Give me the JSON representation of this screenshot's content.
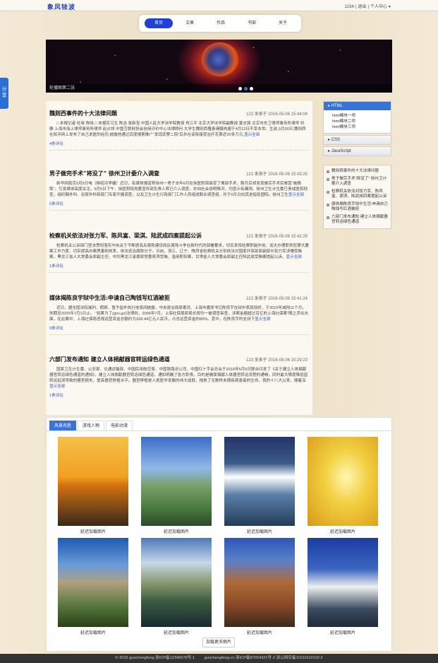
{
  "header": {
    "logo": "象风铱波",
    "user_links": [
      "1234",
      "|",
      "退出",
      "|",
      "个人中心"
    ],
    "nav": [
      "首页",
      "文章",
      "作品",
      "书架",
      "关于"
    ],
    "active_nav": 0
  },
  "banner": {
    "caption": "轮播图第二张",
    "dots": 3,
    "active_dot": 1
  },
  "share": {
    "label": "分享"
  },
  "articles": [
    {
      "title": "魏则西事件的十大法律问题",
      "meta": "123 发表于 2016-05-06 15:44:04",
      "summary": "□ 本报记者 杜晓 陈晓 □ 本报实习生 陈洁 张新宝 中国人民大学法学院教授 肖江平 北京大学法学院副教授 夏志强 北京市东卫律师事务所律师 刘 静 上海市海上律师事务所律师 赵占领 中国互联网协会信用评价中心法律顾问 大学生魏则西罹患滑膜肉瘤于4月12日不幸去世。生前,3月30日,魏则西在知乎网上发布了自己求医的经历,披露他通过百度搜索推广“发现武警二院”后并在该院接受治疗花费近20多万元,",
      "more": "显示全部",
      "comments": "4条评论"
    },
    {
      "title": "男子做完手术“将没了” 徐州卫计委介入调查",
      "meta": "123 发表于 2016-05-06 15:43:25",
      "summary": "新华网南京5月5日电（杨绍功李婕）近日，有媒体报道称徐州一男子去年6月在徐医附院接受了胃部手术，数月后却发现做完手术后胃竟“被摘取”，引发媒体高度关注。5月5日下午，徐医附院党委宣传部负责人称已介入调查，并向社会说明情况，均显示有漏洞。徐州卫生计生委已责成医院彻查，组织胸外科、泌尿外科和部门专家开展调查，以及卫生计生行政部门工作人员组成联合调查组，并于5月日向其进指张固院。徐州卫生",
      "more": "显示全部",
      "comments": "5条评论"
    },
    {
      "title": "检察机关依法对张力军、陈风富、梁淇、陆武成四案提起公诉",
      "meta": "123 发表于 2016-05-06 15:42:29",
      "summary": "检察机关公诉部门坚决贯彻落实中央关于不断提高反腐败建设和反腐败斗争在新时代的部署要求，切实发挥检察职能作用，加大办理职务犯罪大要案工作力度，切实提高办案质量和效率，依法惩治腐败分子。日前，浙江、辽宁、陕西省检察机关分别依法对国家环保部原副部长张力军涉嫌受贿案，黑龙江省人大常委会原副主任、中共黑龙江省委原常委梁淇受贿、滥用职权案，甘肃省人大常委会原副主任陆武成受贿案提起公诉。",
      "more": "显示全部",
      "comments": "1条评论"
    },
    {
      "title": "媒体揭陈良宇狱中生活:申请自己陶钱写红酒被拒",
      "meta": "123 发表于 2016-05-06 15:41:24",
      "summary": "近日，据全国法院减刑、假释、暂予监外执行信息网披露，中央政治局原委员、上海市委原书记陈良宇在狱中表现较好，于2015年减刑11个月，刑期至2025年7月1日止。 “如果为了(gov.gz)法律则，2006年7月，上海社保局原局长祝均一被调查审查，涉案金额超过百亿的上海社保案”随之浮出水面。在此案中，上海社保局违规运营资金总额约为328.44亿元人民币，占总运营资金的80%。其中，在陈良宇的支持下",
      "more": "显示全部",
      "comments": "0条评论"
    },
    {
      "title": "六部门发布通知 建立人体捐献器官转运绿色通道",
      "meta": "123 发表于 2016-05-06 15:29:23",
      "summary": "国家卫生计生委、公安部、交通运输部、中国民用航空局、中国铁路总公司、中国红十字会总会于2016年5月6日联合印发了《关于建立人体捐献器官转运绿色通道的通知》，建立人体捐献器官转运绿色通道。通知明确了各方职责，目的是确保捐献人体器官转运流程的通畅，同时最大限度降低因转运延误导致的器官损失，提高器官移植水平。器官移植是人类医学发展的伟大成就，挽救了无数终末期疾病患者的生命。我的十八大以来，随着深",
      "more": "显示全部",
      "comments": "1条评论"
    }
  ],
  "sidebar": {
    "accordion": [
      {
        "title": "HTML",
        "items": [
          "html模块一项",
          "html模块二项",
          "html模块三项"
        ]
      },
      {
        "title": "CSS",
        "items": []
      },
      {
        "title": "JavaScript",
        "items": []
      }
    ],
    "recent": [
      "魏则西事件的十大法律问题",
      "男子做完手术“将没了” 徐州卫计委介入调查",
      "检察机关依法对张力军、陈风富、梁淇、陆武成四案提起公诉",
      "媒体揭陈良宇狱中生活:申请自己陶钱写红酒被拒",
      "六部门发布通知 建立人体捐献器官转运绿色通道"
    ]
  },
  "gallery": {
    "tabs": [
      "风景名胜",
      "游戏人物",
      "电影动漫"
    ],
    "captions": [
      "延迟加载图片",
      "延迟加载图片",
      "延迟加载图片",
      "延迟加载图片",
      "延迟加载图片",
      "延迟加载图片",
      "延迟加载图片",
      "延迟加载图片"
    ],
    "load_more": "加载更多图片"
  },
  "footer": [
    "© 2016 guochengfeng 浙ICP备12345678号-1",
    "guochengfeng.cn 浙ICP备87654321号-2 浙公网安备11010110110-2"
  ]
}
